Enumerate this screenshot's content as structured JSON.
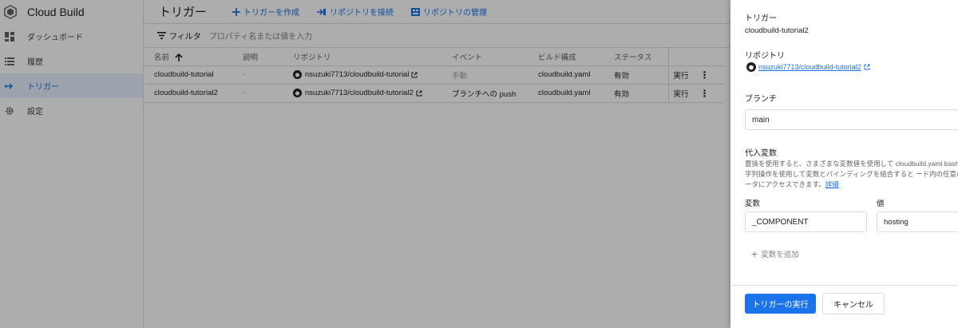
{
  "sidebar": {
    "product_name": "Cloud Build",
    "items": [
      {
        "label": "ダッシュボード"
      },
      {
        "label": "履歴"
      },
      {
        "label": "トリガー"
      },
      {
        "label": "設定"
      }
    ]
  },
  "header": {
    "title": "トリガー",
    "actions": [
      {
        "label": "トリガーを作成"
      },
      {
        "label": "リポジトリを接続"
      },
      {
        "label": "リポジトリの管理"
      }
    ]
  },
  "filter": {
    "label": "フィルタ",
    "placeholder": "プロパティ名または値を入力"
  },
  "table": {
    "columns": [
      "名前",
      "説明",
      "リポジトリ",
      "イベント",
      "ビルド構成",
      "ステータス"
    ],
    "rows": [
      {
        "name": "cloudbuild-tutorial",
        "description": "-",
        "repo": "nsuzuki7713/cloudbuild-tutorial",
        "event": "手動",
        "config": "cloudbuild.yaml",
        "status": "有効",
        "run": "実行"
      },
      {
        "name": "cloudbuild-tutorial2",
        "description": "-",
        "repo": "nsuzuki7713/cloudbuild-tutorial2",
        "event": "ブランチへの push",
        "config": "cloudbuild.yaml",
        "status": "有効",
        "run": "実行"
      }
    ]
  },
  "panel": {
    "trigger_label": "トリガー",
    "trigger_value": "cloudbuild-tutorial2",
    "repo_label": "リポジトリ",
    "repo_value": "nsuzuki7713/cloudbuild-tutorial2",
    "branch_label": "ブランチ",
    "branch_value": "main",
    "subst_label": "代入変数",
    "subst_desc": "置換を使用すると、さまざまな変数値を使用して cloudbuild.yaml bash の文字列操作を使用して変数とバインディングを結合すると ード内の任意のデータにアクセスできます。",
    "subst_link": "詳細",
    "var_label": "変数",
    "value_label": "値",
    "var_value": "_COMPONENT",
    "value_value": "hosting",
    "add_var": "変数を追加",
    "run_button": "トリガーの実行",
    "cancel_button": "キャンセル"
  },
  "colors": {
    "accent": "#1a73e8",
    "scrim": "rgba(0,0,0,0.32)"
  }
}
